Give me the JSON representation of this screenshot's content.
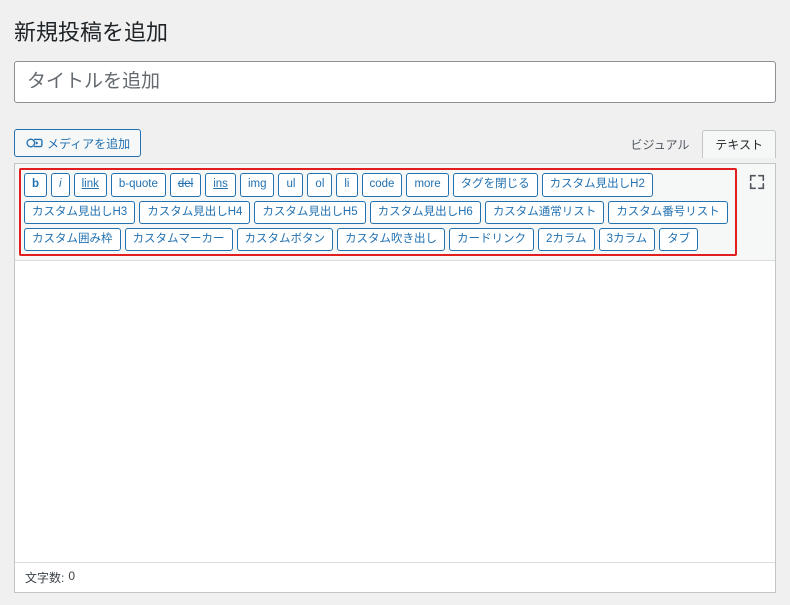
{
  "header": {
    "page_title": "新規投稿を追加"
  },
  "title_field": {
    "placeholder": "タイトルを追加",
    "value": ""
  },
  "media": {
    "add_label": "メディアを追加"
  },
  "tabs": {
    "visual": "ビジュアル",
    "text": "テキスト",
    "active": "text"
  },
  "quicktags": {
    "row1": [
      "b",
      "i",
      "link",
      "b-quote",
      "del",
      "ins",
      "img",
      "ul",
      "ol",
      "li",
      "code",
      "more",
      "タグを閉じる",
      "カスタム見出しH2",
      "カスタム見出しH3"
    ],
    "row2": [
      "カスタム見出しH4",
      "カスタム見出しH5",
      "カスタム見出しH6",
      "カスタム通常リスト",
      "カスタム番号リスト",
      "カスタム囲み枠",
      "カスタムマーカー"
    ],
    "row3": [
      "カスタムボタン",
      "カスタム吹き出し",
      "カードリンク",
      "2カラム",
      "3カラム",
      "タブ"
    ]
  },
  "status": {
    "word_label": "文字数:",
    "word_count": "0"
  },
  "colors": {
    "accent": "#2271b1",
    "highlight_border": "#e11d1d"
  }
}
